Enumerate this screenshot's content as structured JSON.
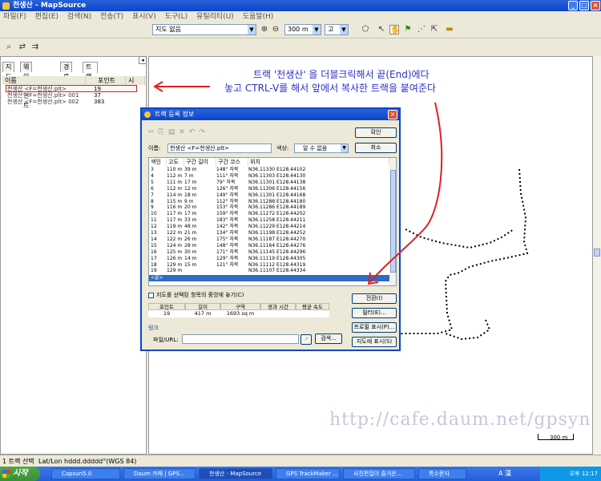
{
  "window": {
    "title": "천생산 - MapSource"
  },
  "menu": [
    "파일(F)",
    "편집(E)",
    "검색(N)",
    "전송(T)",
    "표시(V)",
    "도구(L)",
    "유틸리티(U)",
    "도움말(H)"
  ],
  "toolbar": {
    "map_select": "지도 없음",
    "zoom_select": "300 m",
    "detail_select": "고"
  },
  "left_panel": {
    "tabs": [
      "지도",
      "웨이포인트",
      "경로",
      "트랙(3)"
    ],
    "columns": {
      "name": "이름",
      "points": "포인트",
      "extra": "시"
    },
    "tracks": [
      {
        "name": "천생산 <F=천생산.plt>",
        "points": "19"
      },
      {
        "name": "천생산 <F=천생산.plt> 001",
        "points": "37"
      },
      {
        "name": "천생산 <F=천생산.plt> 002",
        "points": "383"
      }
    ]
  },
  "annotation": {
    "line1": "트랙 '천생산' 을 더블크릭해서 끝(End)에다",
    "line2": "놓고 CTRL-V를 해서 앞에서 복사한 트랙을 붙여준다"
  },
  "dialog": {
    "title": "트랙 등록 정보",
    "ok_label": "확인",
    "cancel_label": "취소",
    "name_label": "이름:",
    "name_value": "천생산 <F=천생산.plt>",
    "color_label": "색상:",
    "color_value": "알 수 없음",
    "columns": [
      "색인",
      "고도",
      "구간 길이",
      "구간 코스",
      "위치"
    ],
    "points": [
      [
        "3",
        "110 m",
        "39 m",
        "148° 자북",
        "N36.11330 E128.44102"
      ],
      [
        "4",
        "112 m",
        "7 m",
        "111° 자북",
        "N36.11303 E128.44130"
      ],
      [
        "5",
        "111 m",
        "17 m",
        "79° 자북",
        "N36.11301 E128.44138"
      ],
      [
        "6",
        "112 m",
        "12 m",
        "126° 자북",
        "N36.11306 E128.44156"
      ],
      [
        "7",
        "114 m",
        "18 m",
        "149° 자북",
        "N36.11301 E128.44168"
      ],
      [
        "8",
        "115 m",
        "9 m",
        "112° 자북",
        "N36.11288 E128.44180"
      ],
      [
        "9",
        "116 m",
        "20 m",
        "153° 자북",
        "N36.11286 E128.44189"
      ],
      [
        "10",
        "117 m",
        "17 m",
        "159° 자북",
        "N36.11272 E128.44202"
      ],
      [
        "11",
        "117 m",
        "33 m",
        "183° 자북",
        "N36.11258 E128.44211"
      ],
      [
        "12",
        "119 m",
        "48 m",
        "142° 자북",
        "N36.11229 E128.44214"
      ],
      [
        "13",
        "122 m",
        "21 m",
        "134° 자북",
        "N36.11198 E128.44252"
      ],
      [
        "14",
        "122 m",
        "26 m",
        "175° 자북",
        "N36.11187 E128.44270"
      ],
      [
        "15",
        "124 m",
        "28 m",
        "148° 자북",
        "N36.11164 E128.44276"
      ],
      [
        "16",
        "125 m",
        "30 m",
        "171° 자북",
        "N36.11145 E128.44296"
      ],
      [
        "17",
        "126 m",
        "14 m",
        "129° 자북",
        "N36.11119 E128.44305"
      ],
      [
        "18",
        "129 m",
        "15 m",
        "121° 자북",
        "N36.11112 E128.44319"
      ],
      [
        "19",
        "129 m",
        "",
        "",
        "N36.11107 E128.44334"
      ]
    ],
    "end_row": "<끝>",
    "center_checkbox": "지도를 선택된 항목의 중앙에 놓기(C)",
    "invert_button": "전환(I)",
    "filter_button": "필터(E)...",
    "profile_button": "프로필 표시(P)...",
    "show_on_map_button": "지도에 표시(S)",
    "stats_headers": [
      "포인트",
      "길이",
      "구역",
      "경과 시간",
      "평균 속도"
    ],
    "stats_values": [
      "19",
      "417 m",
      "1693 sq m",
      "",
      ""
    ],
    "link_label": "링크",
    "file_label": "파일/URL:",
    "search_button": "검색..."
  },
  "map": {
    "watermark": "http://cafe.daum.net/gpsyn",
    "scale": "300 m"
  },
  "status": {
    "left": "1 트랙 선택",
    "coord_format": "Lat/Lon hddd.ddddd°(WGS 84)"
  },
  "taskbar": {
    "start": "시작",
    "tasks": [
      "Capsun5.0",
      "Daum 카페 | GPS...",
      "천생산 - MapSource",
      "GPS TrackMaker ...",
      "사진편집이 즐거운...",
      "특수문자"
    ],
    "clock": "오후 12:17",
    "ime": "A 漢"
  },
  "colors": {
    "annotation_text": "#2d2fc8",
    "arrow": "#e02020",
    "track": "#000000",
    "title_bar": "#0a46c8"
  }
}
